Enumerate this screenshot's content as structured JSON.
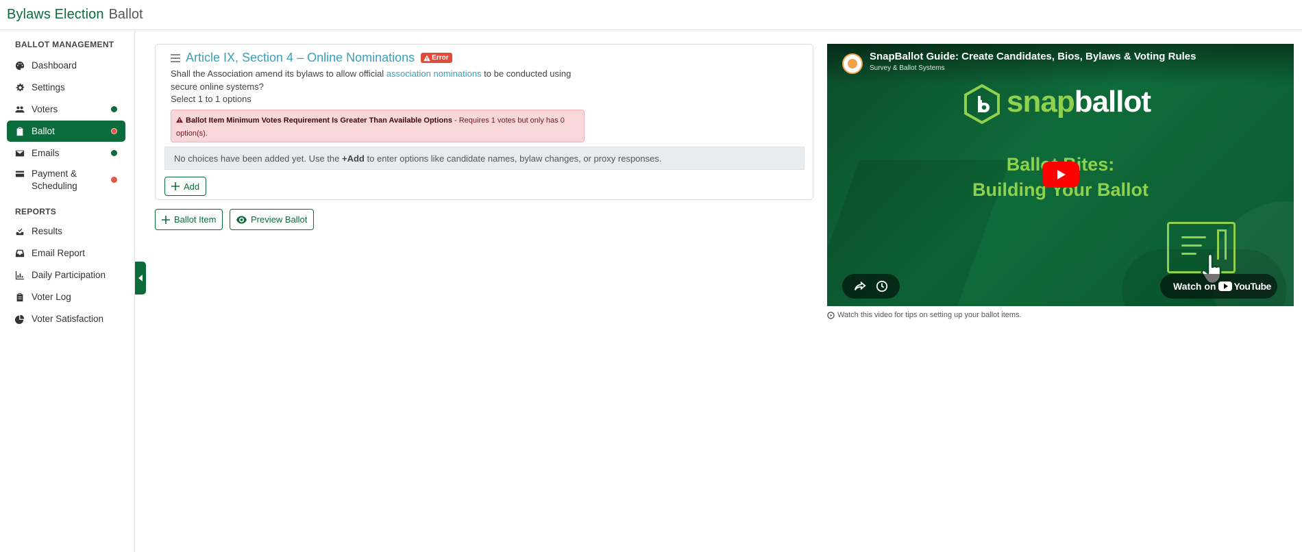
{
  "header": {
    "brand": "Bylaws Election",
    "page": "Ballot"
  },
  "sidebar": {
    "section_management": "BALLOT MANAGEMENT",
    "items": [
      {
        "label": "Dashboard",
        "icon": "palette-icon"
      },
      {
        "label": "Settings",
        "icon": "gear-icon"
      },
      {
        "label": "Voters",
        "icon": "users-icon",
        "status": "green"
      },
      {
        "label": "Ballot",
        "icon": "clipboard-icon",
        "status": "red",
        "active": true
      },
      {
        "label": "Emails",
        "icon": "envelope-icon",
        "status": "green"
      },
      {
        "label": "Payment & Scheduling",
        "icon": "credit-card-icon",
        "status": "red"
      }
    ],
    "section_reports": "REPORTS",
    "reports": [
      {
        "label": "Results",
        "icon": "inbox-check-icon"
      },
      {
        "label": "Email Report",
        "icon": "inbox-icon"
      },
      {
        "label": "Daily Participation",
        "icon": "bar-chart-icon"
      },
      {
        "label": "Voter Log",
        "icon": "clipboard-list-icon"
      },
      {
        "label": "Voter Satisfaction",
        "icon": "pie-chart-icon"
      }
    ]
  },
  "ballot_item": {
    "title": "Article IX, Section 4 – Online Nominations",
    "badge": "Error",
    "question_before": "Shall the Association amend its bylaws to allow official ",
    "question_link": "association nominations",
    "question_after": " to be conducted using secure online systems?",
    "select_note": "Select 1 to 1 options",
    "alert_title": "Ballot Item Minimum Votes Requirement Is Greater Than Available Options",
    "alert_detail": " - Requires 1 votes but only has 0 option(s).",
    "empty_before": "No choices have been added yet. Use the ",
    "empty_bold": "+Add",
    "empty_after": " to enter options like candidate names, bylaw changes, or proxy responses.",
    "add_label": "Add"
  },
  "actions": {
    "ballot_item": "Ballot Item",
    "preview": "Preview Ballot"
  },
  "video": {
    "title": "SnapBallot Guide: Create Candidates, Bios, Bylaws & Voting Rules",
    "channel": "Survey & Ballot Systems",
    "logo_a": "snap",
    "logo_b": "ballot",
    "heading_line1": "Ballot Bites:",
    "heading_line2": "Building Your Ballot",
    "watch_on": "Watch on",
    "youtube": "YouTube",
    "caption": "Watch this video for tips on setting up your ballot items."
  },
  "colors": {
    "brand_green": "#0b6b3a",
    "status_green": "#0b6b3a",
    "status_red": "#e0584a",
    "link_teal": "#3aa1b8",
    "accent_lime": "#8fd14f"
  }
}
